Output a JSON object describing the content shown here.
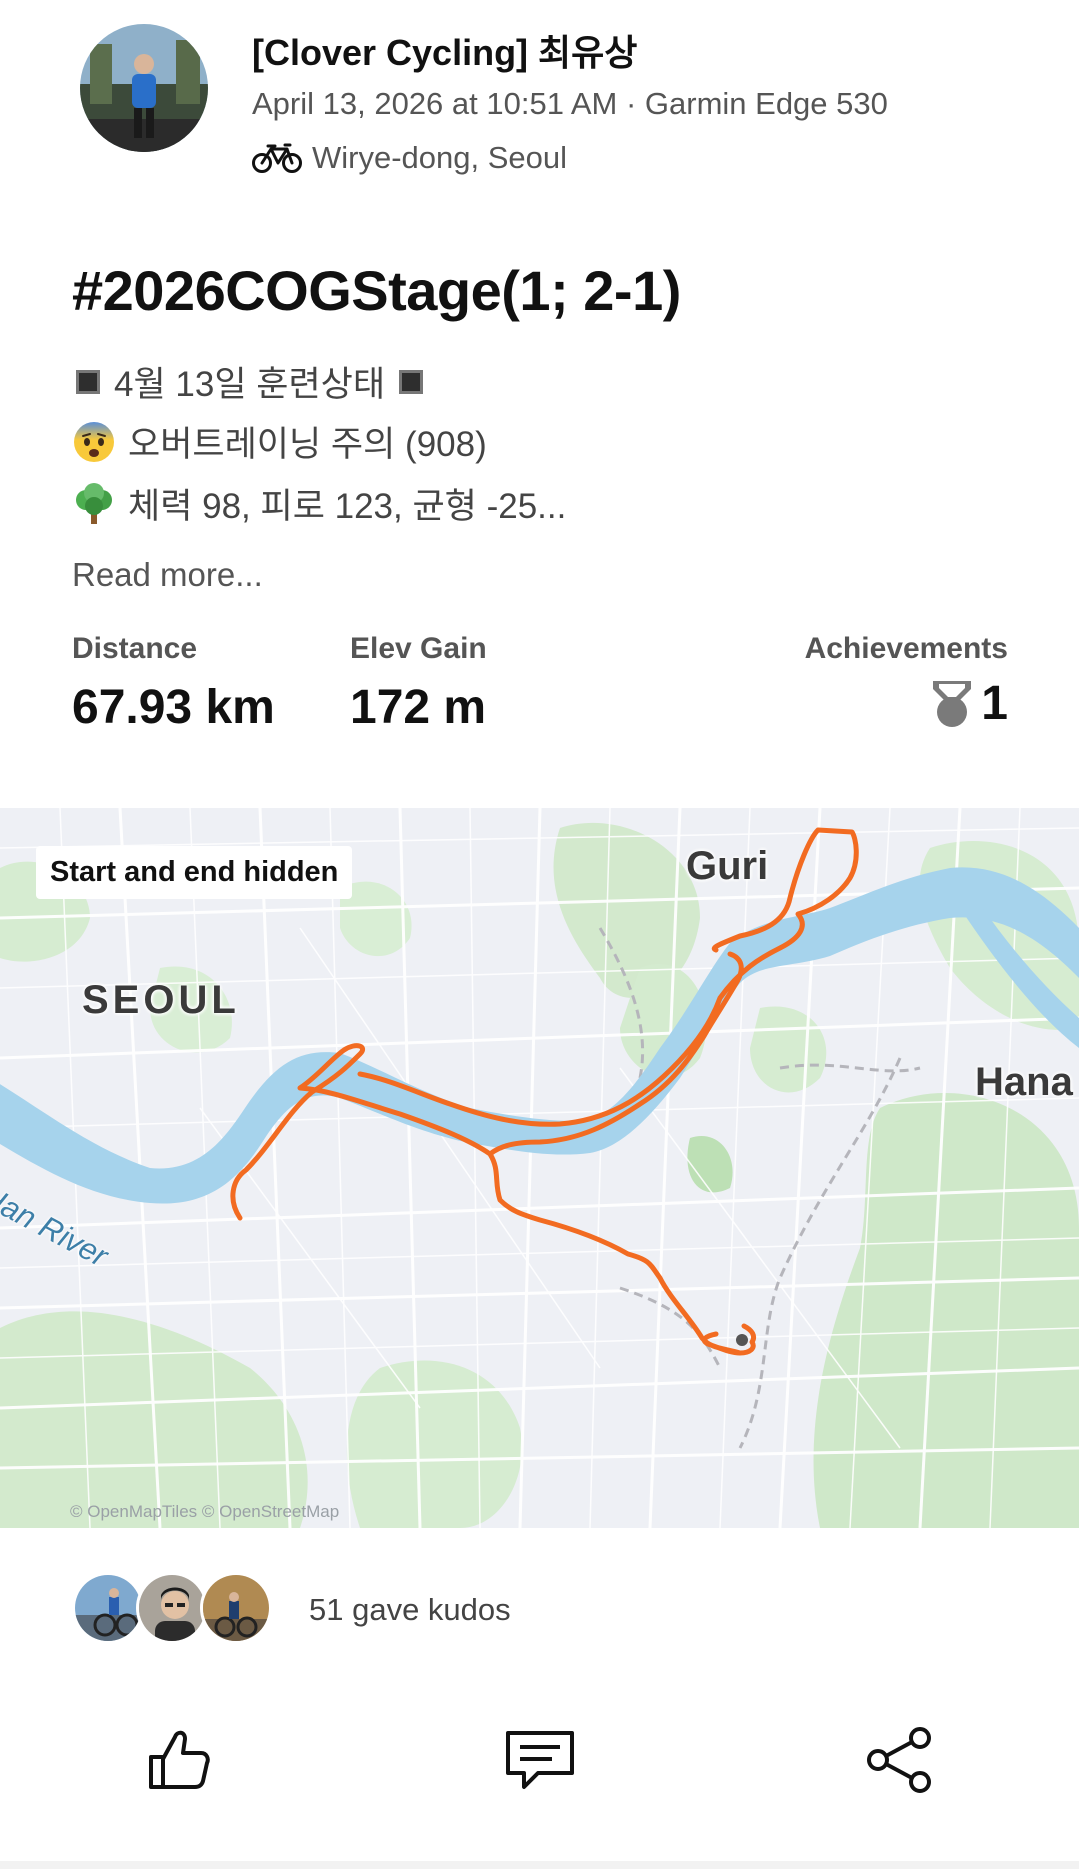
{
  "header": {
    "athlete_name": "[Clover Cycling] 최유상",
    "meta": "April 13, 2026 at 10:51 AM · Garmin Edge 530",
    "location": "Wirye-dong, Seoul"
  },
  "activity": {
    "title": "#2026COGStage(1; 2-1)",
    "description": {
      "line1": "4월 13일 훈련상태",
      "line2": "오버트레이닝 주의 (908)",
      "line3": "체력 98, 피로 123, 균형 -25..."
    },
    "read_more": "Read more..."
  },
  "stats": {
    "distance_label": "Distance",
    "distance_value": "67.93 km",
    "elev_label": "Elev Gain",
    "elev_value": "172 m",
    "achievements_label": "Achievements",
    "achievements_value": "1"
  },
  "map": {
    "hidden_badge": "Start and end hidden",
    "labels": {
      "guri": "Guri",
      "seoul": "SEOUL",
      "hana": "Hana",
      "river": "Han River"
    },
    "attribution": "© OpenMapTiles © OpenStreetMap",
    "route_color": "#f26b21",
    "water_color": "#a6d3ec",
    "park_color": "#cfe8c9"
  },
  "kudos": {
    "text": "51 gave kudos"
  },
  "actions": {
    "kudos_icon": "thumbs-up-icon",
    "comment_icon": "comment-icon",
    "share_icon": "share-icon"
  }
}
